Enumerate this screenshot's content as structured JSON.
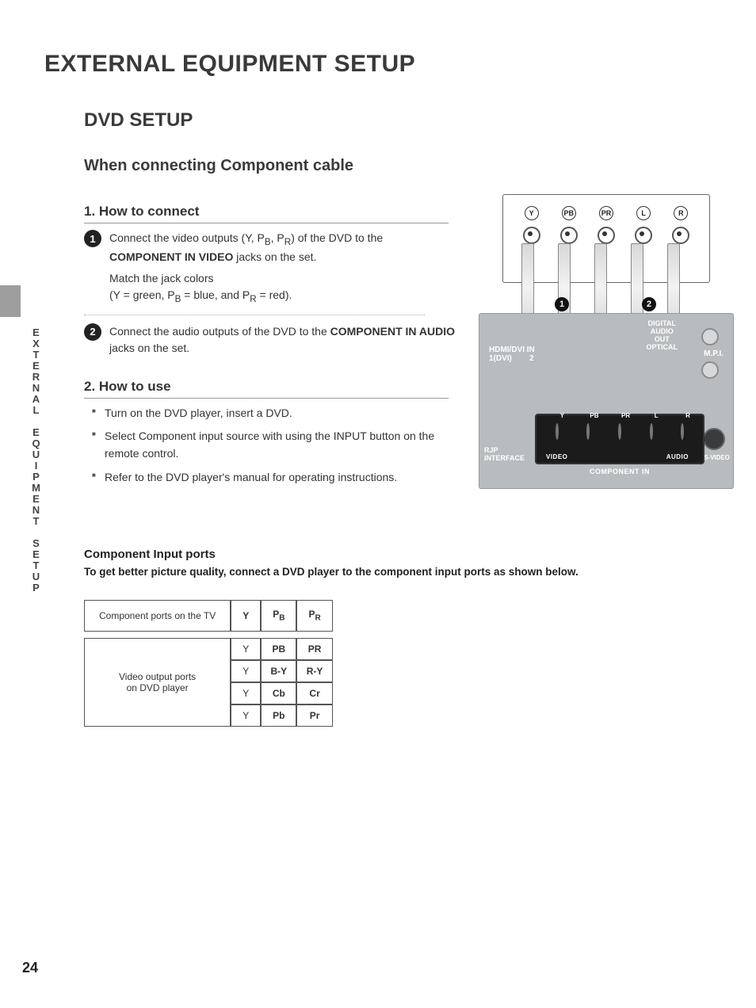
{
  "page_number": "24",
  "side_label": "EXTERNAL EQUIPMENT SETUP",
  "main_title": "EXTERNAL EQUIPMENT SETUP",
  "section_title": "DVD SETUP",
  "subtitle": "When connecting Component cable",
  "step1_title": "1. How to connect",
  "step2_title": "2. How to use",
  "connect": {
    "s1a": "Connect the video outputs (Y, P",
    "s1a_sub1": "B",
    "s1a_mid": ", P",
    "s1a_sub2": "R",
    "s1a_tail": ")  of the DVD  to the ",
    "s1a_bold": "COMPONENT IN VIDEO",
    "s1a_end": " jacks on the set.",
    "s1b": "Match the jack colors",
    "s1c_pre": "(Y = green, P",
    "s1c_sub1": "B",
    "s1c_mid": " = blue, and P",
    "s1c_sub2": "R",
    "s1c_end": " = red).",
    "s2a": "Connect the audio outputs of the DVD to the ",
    "s2a_bold": "COMPONENT IN AUDIO",
    "s2a_end": " jacks on the set."
  },
  "use": {
    "b1": "Turn on the DVD player, insert a DVD.",
    "b2_pre": "Select ",
    "b2_bold1": "Component",
    "b2_mid": " input source with using the ",
    "b2_bold2": "INPUT",
    "b2_end": " button on the remote control.",
    "b3": "Refer to the DVD player's manual for operating instructions."
  },
  "ports": {
    "heading": "Component Input ports",
    "desc": "To get better picture quality, connect a DVD player to the component input ports as shown below.",
    "row_tv_label": "Component ports on the TV",
    "row_dvd_label_1": "Video output ports",
    "row_dvd_label_2": "on DVD player",
    "headers": {
      "y": "Y",
      "pb": "P",
      "pb_sub": "B",
      "pr": "P",
      "pr_sub": "R"
    },
    "dvd_rows": [
      {
        "y": "Y",
        "pb": "PB",
        "pr": "PR"
      },
      {
        "y": "Y",
        "pb": "B-Y",
        "pr": "R-Y"
      },
      {
        "y": "Y",
        "pb": "Cb",
        "pr": "Cr"
      },
      {
        "y": "Y",
        "pb": "Pb",
        "pr": "Pr"
      }
    ]
  },
  "diagram": {
    "top_jacks": [
      "Y",
      "PB",
      "PR",
      "L",
      "R"
    ],
    "hdmi": "HDMI/DVI IN",
    "hdmi1": "1(DVI)",
    "hdmi2": "2",
    "digital": "DIGITAL\nAUDIO\nOUT\nOPTICAL",
    "mpi": "M.P.I.",
    "rjp": "RJP\nINTERFACE",
    "svideo": "S-VIDEO",
    "comp_in": "COMPONENT IN",
    "video": "VIDEO",
    "audio": "AUDIO",
    "labels": {
      "y": "Y",
      "pb": "PB",
      "pr": "PR",
      "l": "L",
      "r": "R"
    },
    "markers": {
      "one": "1",
      "two": "2"
    }
  }
}
